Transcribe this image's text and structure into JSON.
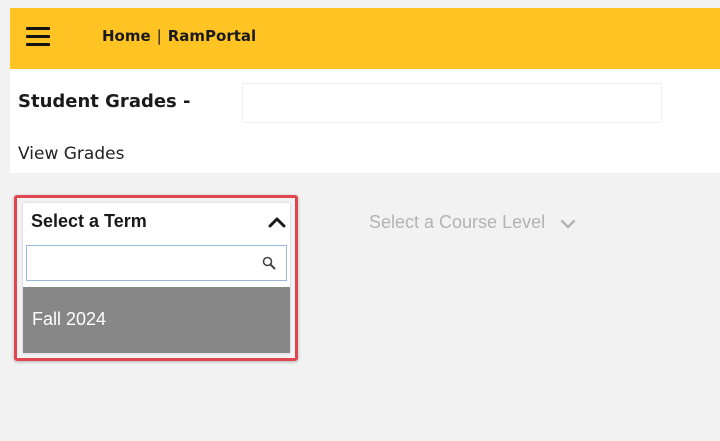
{
  "header": {
    "breadcrumb_home": "Home",
    "breadcrumb_separator": "|",
    "breadcrumb_app": "RamPortal",
    "background_color": "#ffc424"
  },
  "page": {
    "title": "Student Grades -",
    "subtitle": "View Grades"
  },
  "term_dropdown": {
    "label": "Select a Term",
    "search_value": "",
    "search_placeholder": "",
    "options": [
      {
        "label": "Fall 2024",
        "highlighted": true
      }
    ],
    "highlight_color": "#e04550"
  },
  "course_level_dropdown": {
    "label": "Select a Course Level",
    "enabled": false
  },
  "icons": {
    "menu": "hamburger-icon",
    "term_toggle": "chevron-up-icon",
    "search": "search-icon",
    "course_toggle": "chevron-down-icon"
  }
}
